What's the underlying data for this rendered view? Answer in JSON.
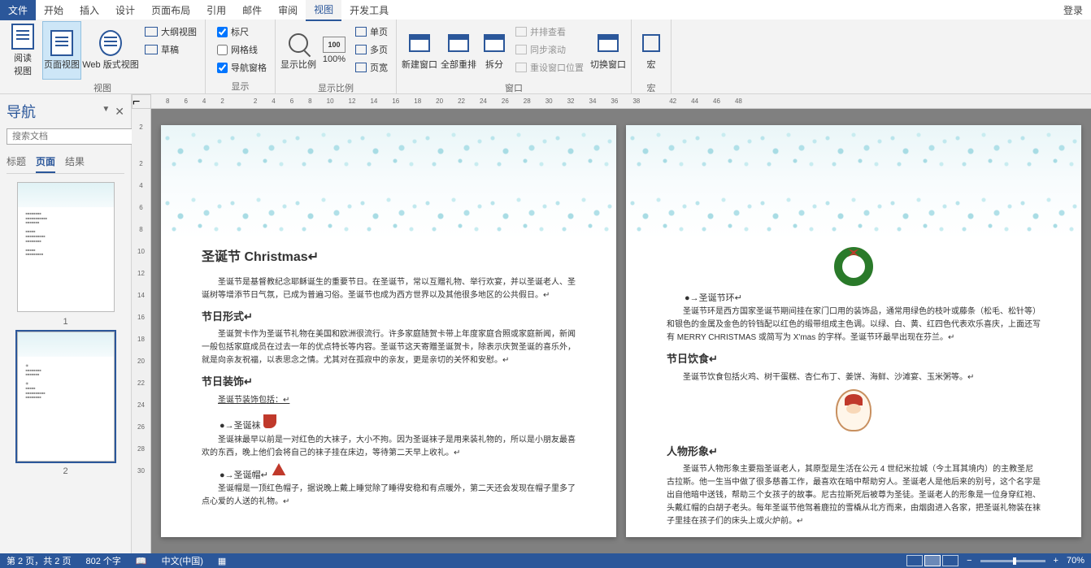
{
  "menu": {
    "file": "文件",
    "home": "开始",
    "insert": "插入",
    "design": "设计",
    "layout": "页面布局",
    "references": "引用",
    "mailings": "邮件",
    "review": "审阅",
    "view": "视图",
    "devtools": "开发工具",
    "login": "登录"
  },
  "ribbon": {
    "views": {
      "read": "阅读\n视图",
      "page": "页面视图",
      "web": "Web 版式视图",
      "outline": "大纲视图",
      "draft": "草稿",
      "group": "视图"
    },
    "show": {
      "ruler": "标尺",
      "gridlines": "网格线",
      "navpane": "导航窗格",
      "group": "显示"
    },
    "zoom": {
      "zoom": "显示比例",
      "p100": "100%",
      "onepage": "单页",
      "multipage": "多页",
      "pagewidth": "页宽",
      "group": "显示比例"
    },
    "window": {
      "newwin": "新建窗口",
      "arrange": "全部重排",
      "split": "拆分",
      "sidebyside": "并排查看",
      "syncscroll": "同步滚动",
      "resetpos": "重设窗口位置",
      "switch": "切换窗口",
      "group": "窗口"
    },
    "macros": {
      "macro": "宏",
      "group": "宏"
    }
  },
  "nav": {
    "title": "导航",
    "search_placeholder": "搜索文档",
    "tabs": {
      "headings": "标题",
      "pages": "页面",
      "results": "结果"
    },
    "thumb1": "1",
    "thumb2": "2"
  },
  "rulerH": [
    "8",
    "6",
    "4",
    "2",
    "",
    "2",
    "4",
    "6",
    "8",
    "10",
    "12",
    "14",
    "16",
    "18",
    "20",
    "22",
    "24",
    "26",
    "28",
    "30",
    "32",
    "34",
    "36",
    "38",
    "",
    "42",
    "44",
    "46",
    "48"
  ],
  "rulerV": [
    "2",
    "",
    "2",
    "4",
    "6",
    "8",
    "10",
    "12",
    "14",
    "16",
    "18",
    "20",
    "22",
    "24",
    "26",
    "28",
    "30"
  ],
  "doc": {
    "page1": {
      "h1": "圣诞节 Christmas↵",
      "p1": "圣诞节是基督教纪念耶稣诞生的重要节日。在圣诞节，常以互赠礼物、举行欢宴，并以圣诞老人、圣诞树等增添节日气氛，已成为普遍习俗。圣诞节也成为西方世界以及其他很多地区的公共假日。↵",
      "h2a": "节日形式↵",
      "p2": "圣诞贺卡作为圣诞节礼物在美国和欧洲很流行。许多家庭随贺卡带上年度家庭合照或家庭新闻，新闻一般包括家庭成员在过去一年的优点特长等内容。圣诞节这天寄赠圣诞贺卡，除表示庆贺圣诞的喜乐外，就是向亲友祝福，以表思念之情。尤其对在孤寂中的亲友，更是亲切的关怀和安慰。↵",
      "h2b": "节日装饰↵",
      "p3": "圣诞节装饰包括：↵",
      "li1": "●→圣诞袜",
      "p4": "圣诞袜最早以前是一对红色的大袜子，大小不拘。因为圣诞袜子是用来装礼物的，所以是小朋友最喜欢的东西，晚上他们会将自己的袜子挂在床边，等待第二天早上收礼。↵",
      "li2": "●→圣诞帽↵",
      "p5": "圣诞帽是一顶红色帽子，据说晚上戴上睡觉除了睡得安稳和有点暖外，第二天还会发现在帽子里多了点心爱的人送的礼物。↵"
    },
    "page2": {
      "li1": "●→圣诞节环↵",
      "p1": "圣诞节环是西方国家圣诞节期间挂在家门口用的装饰品，通常用绿色的枝叶或藤条（松毛、松针等）和银色的金属及金色的铃铛配以红色的缎带组成主色调。以绿、白、黄、红四色代表欢乐喜庆，上面还写有 MERRY CHRISTMAS 或简写为 X'mas 的字样。圣诞节环最早出现在芬兰。↵",
      "h2a": "节日饮食↵",
      "p2": "圣诞节饮食包括火鸡、树干蛋糕、杏仁布丁、姜饼、海鲜、沙滩宴、玉米粥等。↵",
      "h2b": "人物形象↵",
      "p3": "圣诞节人物形象主要指圣诞老人，其原型是生活在公元 4 世纪米拉城（今土耳其境内）的主教圣尼古拉斯。他一生当中做了很多慈善工作，最喜欢在暗中帮助穷人。圣诞老人是他后来的别号，这个名字是出自他暗中送钱，帮助三个女孩子的故事。尼古拉斯死后被尊为圣徒。圣诞老人的形象是一位身穿红袍、头戴红帽的白胡子老头。每年圣诞节他驾着鹿拉的雪橇从北方而来，由烟囱进入各家，把圣诞礼物装在袜子里挂在孩子们的床头上或火炉前。↵"
    }
  },
  "status": {
    "page": "第 2 页，共 2 页",
    "words": "802 个字",
    "lang": "中文(中国)",
    "zoom": "70%"
  }
}
